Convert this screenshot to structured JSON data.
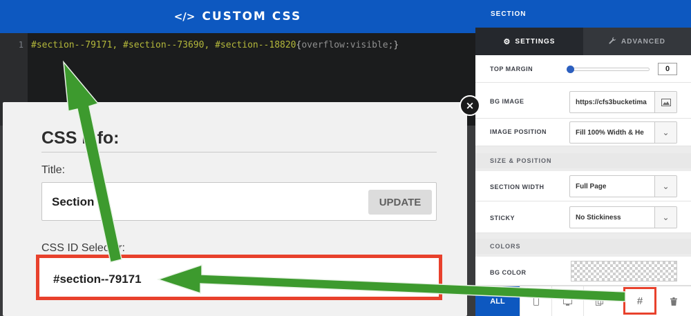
{
  "editor": {
    "title": "CUSTOM CSS",
    "title_icon": "</>",
    "line_number": "1",
    "code_selectors": "#section--79171, #section--73690, #section--18820",
    "code_open_brace": "{",
    "code_property": "overflow:visible;",
    "code_close_brace": "}"
  },
  "modal": {
    "heading": "CSS Info:",
    "title_label": "Title:",
    "title_value": "Section",
    "update_label": "UPDATE",
    "id_label": "CSS ID Selector:",
    "id_value": "#section--79171",
    "close_glyph": "×"
  },
  "panel": {
    "header": "SECTION",
    "tabs": [
      {
        "label": "SETTINGS",
        "icon": "gear-icon",
        "glyph": "⚙",
        "active": true
      },
      {
        "label": "ADVANCED",
        "icon": "wrench-icon",
        "glyph": "🔧",
        "active": false
      }
    ],
    "top_margin": {
      "label": "TOP MARGIN",
      "value": "0",
      "level": 0
    },
    "bg_image": {
      "label": "BG IMAGE",
      "value": "https://cfs3bucketima"
    },
    "image_position": {
      "label": "IMAGE POSITION",
      "value": "Fill 100% Width & He"
    },
    "size_position_header": "SIZE & POSITION",
    "section_width": {
      "label": "SECTION WIDTH",
      "value": "Full Page"
    },
    "sticky": {
      "label": "STICKY",
      "value": "No Stickiness"
    },
    "colors_header": "COLORS",
    "bg_color": {
      "label": "BG COLOR"
    },
    "toolbar": {
      "all_label": "ALL",
      "hash_glyph": "#",
      "trash_glyph": "🗑"
    }
  },
  "colors": {
    "brand_blue": "#0d58c0",
    "highlight_red": "#e8412c",
    "arrow_green": "#3d9a2e"
  }
}
